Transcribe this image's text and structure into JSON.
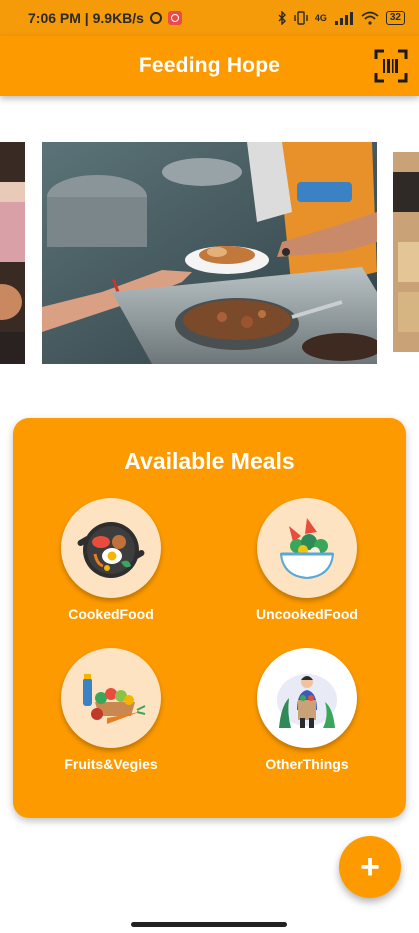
{
  "status_bar": {
    "time": "7:06 PM | 9.9KB/s",
    "network": "4G",
    "battery": "32"
  },
  "app_bar": {
    "title": "Feeding Hope",
    "scan_icon": "barcode-scan-icon"
  },
  "carousel": {
    "images": [
      "food-serving-photo-left",
      "food-serving-photo-main",
      "food-serving-photo-right"
    ]
  },
  "meals": {
    "title": "Available Meals",
    "items": [
      {
        "label": "CookedFood",
        "icon": "cooked-food-icon"
      },
      {
        "label": "UncookedFood",
        "icon": "uncooked-food-icon"
      },
      {
        "label": "Fruits&Vegies",
        "icon": "fruits-vegetables-icon"
      },
      {
        "label": "OtherThings",
        "icon": "other-things-icon"
      }
    ]
  },
  "fab": {
    "symbol": "+",
    "icon": "add-icon"
  },
  "colors": {
    "primary": "#fd9a00",
    "circle_bg": "#fde3c1",
    "text_light": "#ffffff"
  }
}
